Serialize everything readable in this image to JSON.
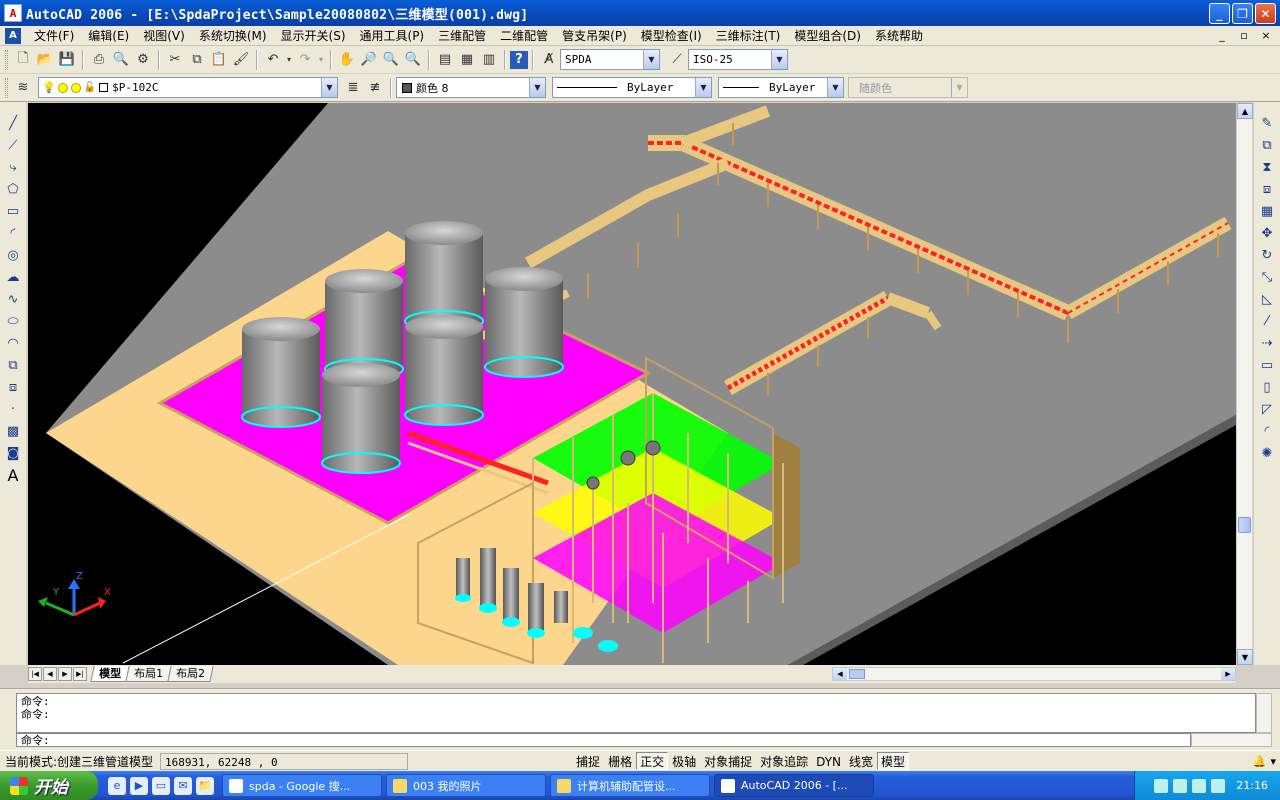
{
  "window": {
    "app_icon": "autocad-a-icon",
    "title": "AutoCAD 2006 - [E:\\SpdaProject\\Sample20080802\\三维模型(001).dwg]",
    "controls": [
      "minimize-icon",
      "restore-icon",
      "close-icon"
    ]
  },
  "menu": {
    "items": [
      "文件(F)",
      "编辑(E)",
      "视图(V)",
      "系统切换(M)",
      "显示开关(S)",
      "通用工具(P)",
      "三维配管",
      "二维配管",
      "管支吊架(P)",
      "模型检查(I)",
      "三维标注(T)",
      "模型组合(D)",
      "系统帮助"
    ],
    "mdi_controls": [
      "_",
      "▫",
      "×"
    ]
  },
  "toolbar1": {
    "text_style": "SPDA",
    "dim_style": "ISO-25"
  },
  "toolbar2": {
    "layer": "$P-102C",
    "color": "颜色 8",
    "linetype": "ByLayer",
    "lineweight": "ByLayer",
    "plotstyle": "随颜色"
  },
  "ucs_axes": {
    "x": "X",
    "y": "Y",
    "z": "Z"
  },
  "layout_tabs": [
    "模型",
    "布局1",
    "布局2"
  ],
  "active_tab": "模型",
  "command": {
    "history": [
      "命令:",
      "命令:"
    ],
    "prompt": "命令:"
  },
  "status": {
    "mode": "当前模式:创建三维管道模型",
    "coordinates": "168931, 62248 , 0",
    "toggles": [
      "捕捉",
      "栅格",
      "正交",
      "极轴",
      "对象捕捉",
      "对象追踪",
      "DYN",
      "线宽",
      "模型"
    ],
    "pressed": [
      "正交",
      "模型"
    ]
  },
  "taskbar": {
    "start": "开始",
    "tasks": [
      {
        "label": "spda - Google 搜...",
        "active": false
      },
      {
        "label": "003 我的照片",
        "active": false
      },
      {
        "label": "计算机辅助配管设...",
        "active": false
      },
      {
        "label": "AutoCAD 2006 - [...",
        "active": true
      }
    ],
    "time": "21:16"
  },
  "colors": {
    "titlebar": "#0a5fd8",
    "viewport_bg": "#000000",
    "ground_gray": "#808080",
    "pad_tan": "#fcd68c",
    "tank_pad_magenta": "#ff00ff",
    "floor_green": "#00ff00",
    "floor_yellow": "#ffff00",
    "pipe_red": "#ff2020",
    "rack_tan": "#e8c880"
  }
}
